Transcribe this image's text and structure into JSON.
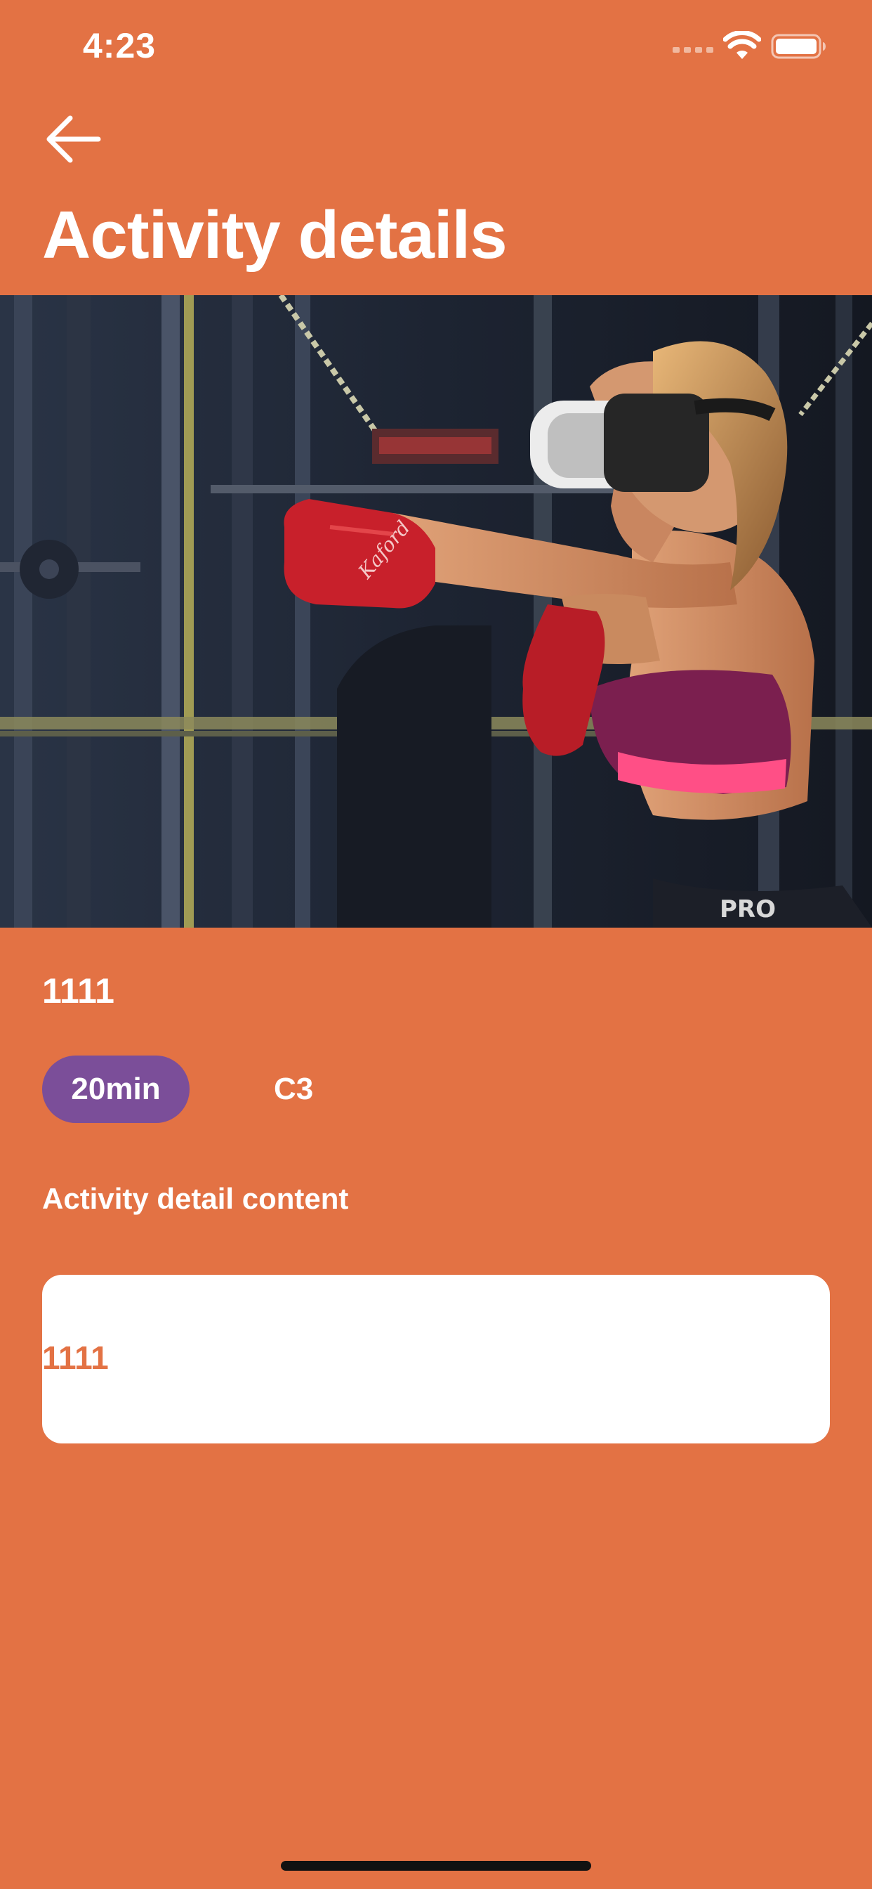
{
  "status_bar": {
    "time": "4:23"
  },
  "header": {
    "title": "Activity details"
  },
  "activity": {
    "name": "1111",
    "duration": "20min",
    "level": "C3",
    "section_heading": "Activity detail content",
    "content": "1111"
  },
  "hero": {
    "glove_text": "Kaford",
    "shorts_text": "PRO"
  },
  "colors": {
    "background": "#E37244",
    "chip": "#7B4E99",
    "card": "#FFFFFF",
    "accent_text": "#E37244"
  },
  "icons": {
    "back": "arrow-left-icon",
    "signal": "cellular-signal-icon",
    "wifi": "wifi-icon",
    "battery": "battery-icon"
  }
}
